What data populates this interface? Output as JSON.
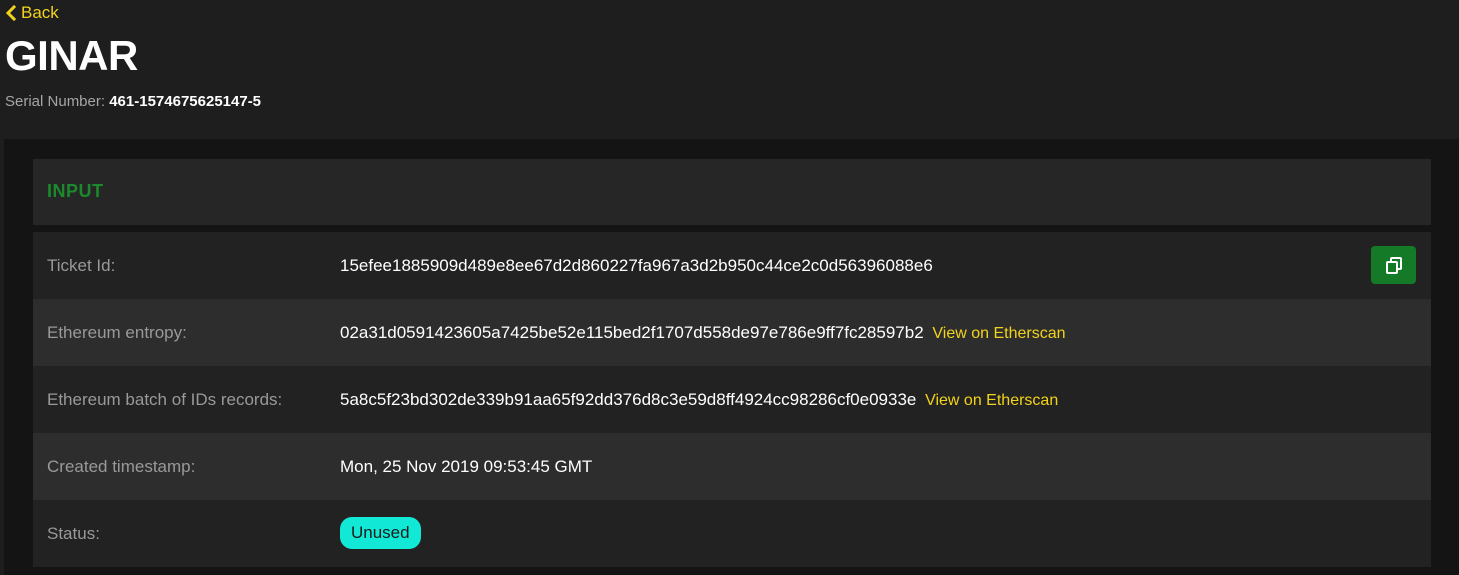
{
  "nav": {
    "back_label": "Back"
  },
  "header": {
    "title": "GINAR",
    "serial_label": "Serial Number:",
    "serial_value": "461-1574675625147-5"
  },
  "card": {
    "title": "INPUT"
  },
  "rows": [
    {
      "label": "Ticket Id:",
      "value": "15efee1885909d489e8ee67d2d860227fa967a3d2b950c44ce2c0d56396088e6"
    },
    {
      "label": "Ethereum entropy:",
      "value": "02a31d0591423605a7425be52e115bed2f1707d558de97e786e9ff7fc28597b2",
      "link": "View on Etherscan"
    },
    {
      "label": "Ethereum batch of IDs records:",
      "value": "5a8c5f23bd302de339b91aa65f92dd376d8c3e59d8ff4924cc98286cf0e0933e",
      "link": "View on Etherscan"
    },
    {
      "label": "Created timestamp:",
      "value": "Mon, 25 Nov 2019 09:53:45 GMT"
    },
    {
      "label": "Status:",
      "value": "Unused"
    }
  ],
  "colors": {
    "accent_yellow": "#f2d31b",
    "accent_green": "#157a28",
    "status_unused": "#12e8d6"
  },
  "icons": {
    "back": "chevron-left-icon",
    "copy": "copy-icon"
  }
}
